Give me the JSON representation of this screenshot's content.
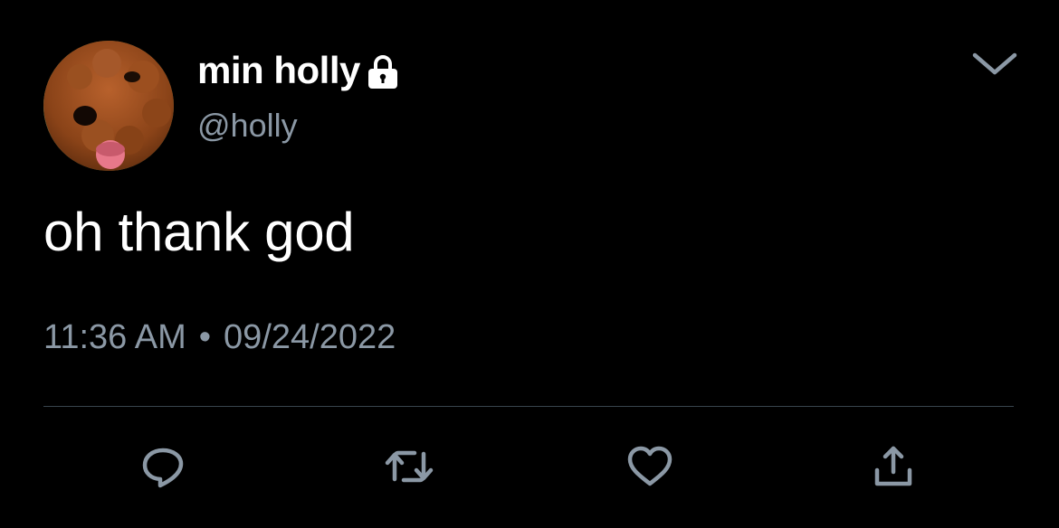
{
  "user": {
    "display_name": "min holly",
    "handle": "@holly",
    "protected_icon": "lock-icon",
    "avatar": "dog-avatar"
  },
  "tweet": {
    "text": "oh thank god",
    "time": "11:36 AM",
    "separator": "•",
    "date": "09/24/2022"
  },
  "header": {
    "more_icon": "chevron-down-icon"
  },
  "actions": [
    {
      "name": "reply",
      "icon": "reply-icon"
    },
    {
      "name": "retweet",
      "icon": "retweet-icon"
    },
    {
      "name": "like",
      "icon": "heart-icon"
    },
    {
      "name": "share",
      "icon": "share-icon"
    }
  ],
  "colors": {
    "background": "#000000",
    "primary_text": "#ffffff",
    "secondary_text": "#8b98a5",
    "divider": "#38444d"
  }
}
